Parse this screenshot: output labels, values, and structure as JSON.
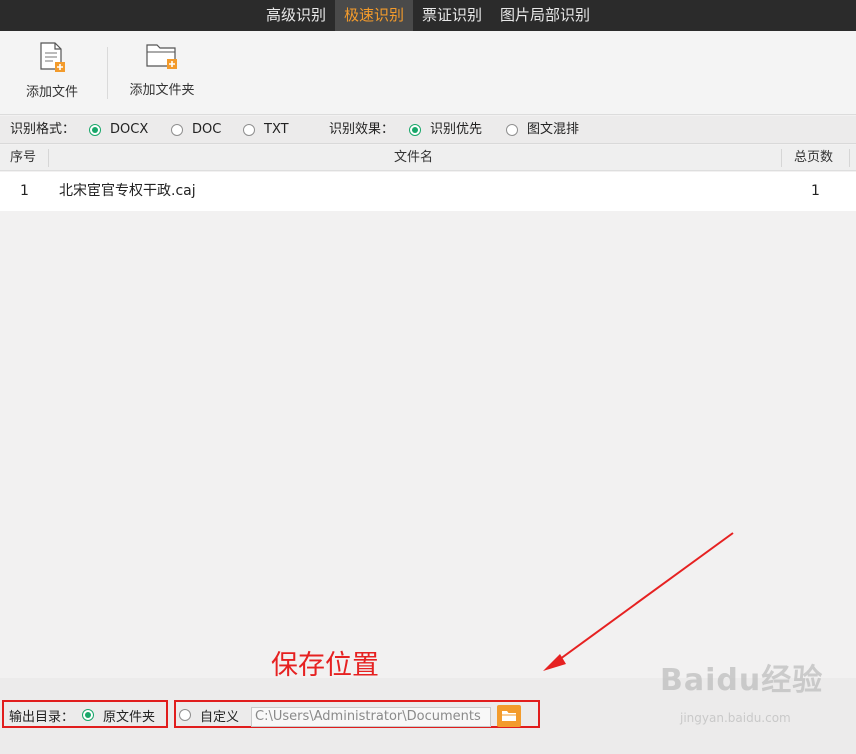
{
  "tabs": [
    {
      "label": "高级识别",
      "active": false
    },
    {
      "label": "极速识别",
      "active": true
    },
    {
      "label": "票证识别",
      "active": false
    },
    {
      "label": "图片局部识别",
      "active": false
    }
  ],
  "toolbar": {
    "add_file_label": "添加文件",
    "add_folder_label": "添加文件夹"
  },
  "options": {
    "format_label": "识别格式：",
    "formats": [
      {
        "label": "DOCX",
        "selected": true
      },
      {
        "label": "DOC",
        "selected": false
      },
      {
        "label": "TXT",
        "selected": false
      }
    ],
    "effect_label": "识别效果：",
    "effects": [
      {
        "label": "识别优先",
        "selected": true
      },
      {
        "label": "图文混排",
        "selected": false
      }
    ]
  },
  "table": {
    "headers": {
      "index": "序号",
      "filename": "文件名",
      "pages": "总页数"
    },
    "rows": [
      {
        "index": "1",
        "filename": "北宋宦官专权干政.caj",
        "pages": "1"
      }
    ]
  },
  "annotation": "保存位置",
  "output": {
    "label": "输出目录：",
    "original_folder": "原文件夹",
    "custom": "自定义",
    "path": "C:\\Users\\Administrator\\Documents"
  },
  "colors": {
    "accent_orange": "#f39b2c",
    "radio_green": "#19a76a",
    "annotation_red": "#e62121"
  },
  "watermark": {
    "brand": "Baidu经验",
    "url": "jingyan.baidu.com"
  }
}
